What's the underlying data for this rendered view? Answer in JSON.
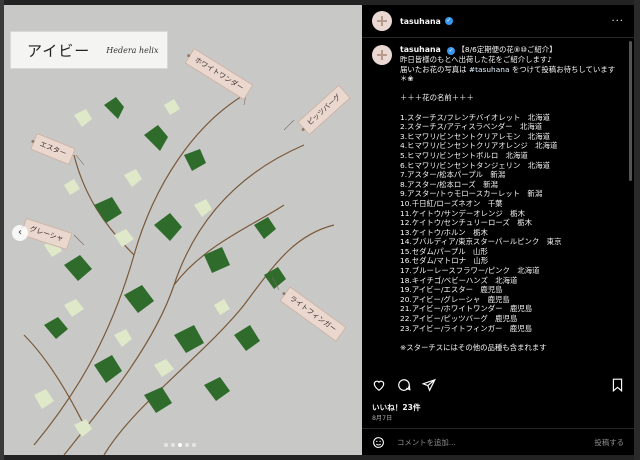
{
  "image": {
    "title_jp": "アイビー",
    "title_latin": "Hedera helix",
    "tags": [
      "ホワイトワンダー",
      "ピッツバーグ",
      "エスター",
      "グレーシャ",
      "ライトフィンガー"
    ],
    "slide_count": 5,
    "active_slide": 3
  },
  "post": {
    "username": "tasuhana",
    "caption_header": "【8/6定期便の花⑧⑩ご紹介】",
    "caption_lines": [
      "昨日皆様のもとへ出荷した花をご紹介します♪",
      "届いたお花の写真は",
      "をつけて投稿お待ちしています"
    ],
    "hashtag": "#tasuhana",
    "caption_emoji": "＊❀",
    "list_heading": "＋＋＋花の名前＋＋＋",
    "items": [
      "1.スターチス/フレンチバイオレット　北海道",
      "2.スターチス/アティスラベンダー　北海道",
      "3.ヒマワリ/ビンセントクリアレモン　北海道",
      "4.ヒマワリ/ビンセントクリアオレンジ　北海道",
      "5.ヒマワリ/ビンセントボルロ　北海道",
      "6.ヒマワリ/ビンセントタンジェリン　北海道",
      "7.アスター/松本パープル　新潟",
      "8.アスター/松本ローズ　新潟",
      "9.アスター/トゥモロースカーレット　新潟",
      "10.千日紅/ローズネオン　千葉",
      "11.ケイトウ/サンデーオレンジ　栃木",
      "12.ケイトウ/センチュリーローズ　栃木",
      "13.ケイトウ/ホルン　栃木",
      "14.ブバルディア/東京スターパールピンク　東京",
      "15.セダム/パープル　山形",
      "16.セダム/マトロナ　山形",
      "17.ブルーレースフラワー/ピンク　北海道",
      "18.キイチゴ/ベビーハンズ　北海道",
      "19.アイビー/エスター　鹿児島",
      "20.アイビー/グレーシャ　鹿児島",
      "21.アイビー/ホワイトワンダー　鹿児島",
      "22.アイビー/ピッツバーグ　鹿児島",
      "23.アイビー/ライトフィンガー　鹿児島"
    ],
    "footnote": "※スターチスにはその他の品種も含まれます",
    "likes": "いいね！23件",
    "date": "8月7日",
    "comment_placeholder": "コメントを追加...",
    "post_button": "投稿する"
  },
  "colors": {
    "background": "#000000",
    "text": "#f5f5f5",
    "verified": "#3897f0",
    "muted": "#a8a8a8",
    "tag": "#ead8cf"
  },
  "icons": [
    "more-icon",
    "heart-icon",
    "comment-icon",
    "share-icon",
    "save-icon",
    "emoji-icon",
    "chevron-left-icon",
    "verified-icon",
    "avatar-plus-icon"
  ]
}
